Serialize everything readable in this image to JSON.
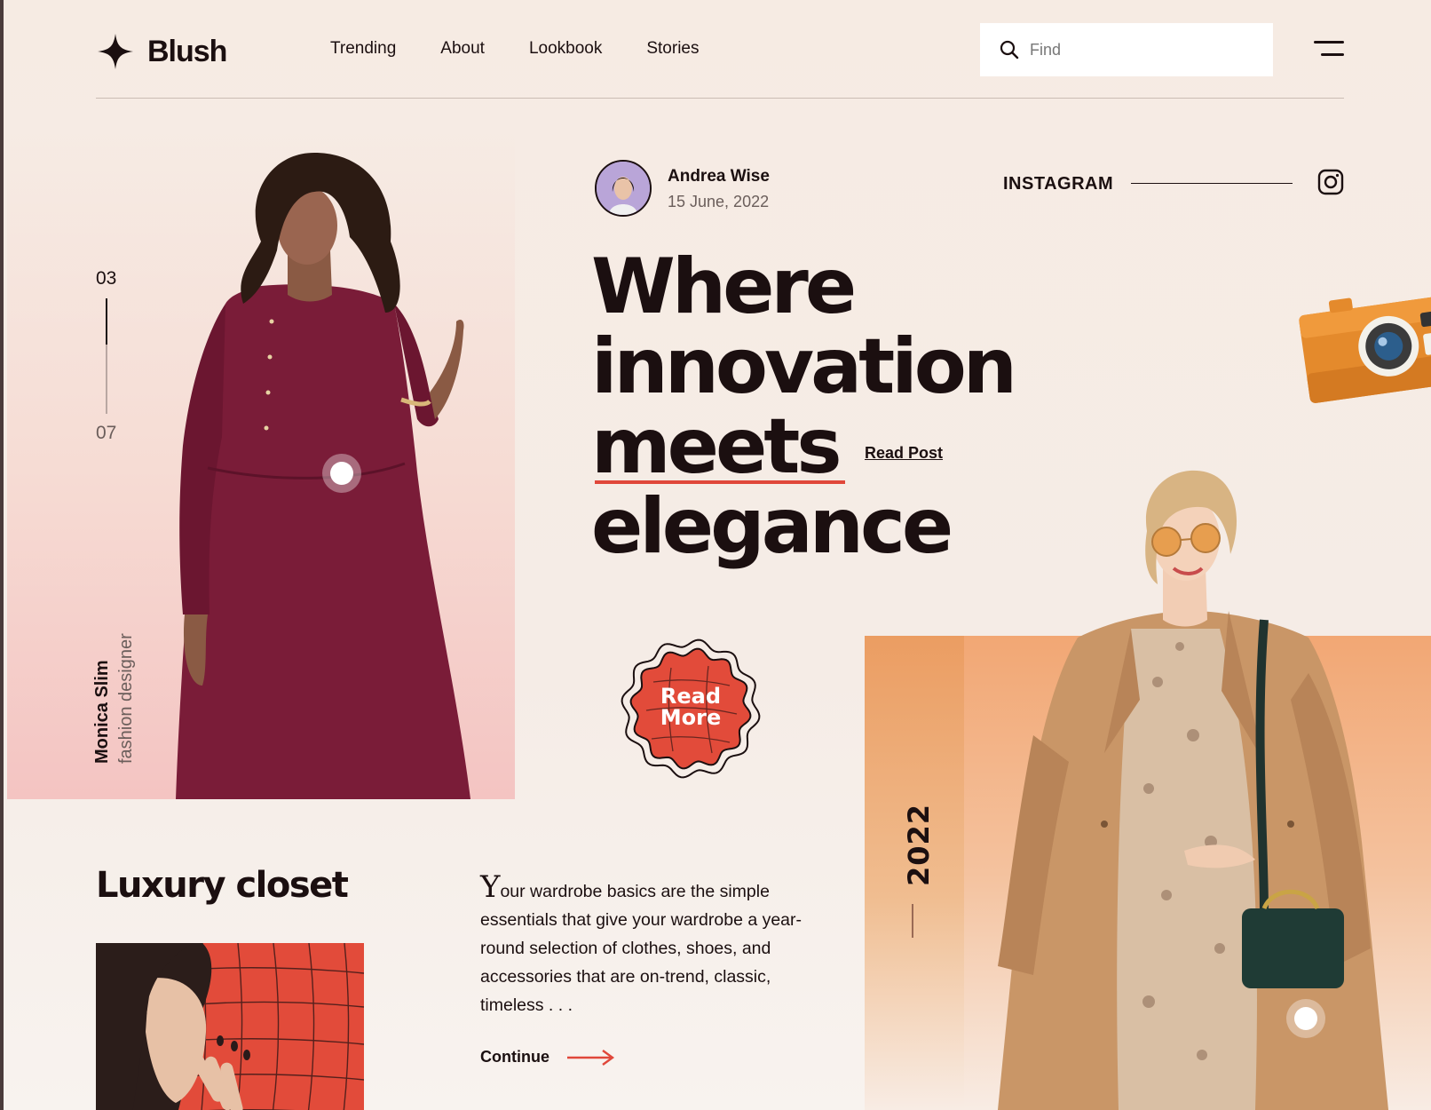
{
  "brand": {
    "name": "Blush",
    "accent": "#e0473a"
  },
  "nav": {
    "items": [
      "Trending",
      "About",
      "Lookbook",
      "Stories"
    ]
  },
  "search": {
    "placeholder": "Find",
    "value": ""
  },
  "slide_counter": {
    "current": "03",
    "total": "07"
  },
  "designer": {
    "name": "Monica Slim",
    "role": "fashion designer"
  },
  "author": {
    "name": "Andrea Wise",
    "date": "15 June, 2022"
  },
  "social": {
    "label": "INSTAGRAM"
  },
  "headline": {
    "line1": "Where",
    "line2": "innovation",
    "line3": "meets",
    "line4": "elegance"
  },
  "read_post": "Read Post",
  "read_more": {
    "line1": "Read",
    "line2": "More"
  },
  "year": "2022",
  "section": {
    "title": "Luxury closet",
    "drop_cap": "Y",
    "body": "our wardrobe basics are the simple essentials that give your wardrobe a year-round selection of clothes, shoes, and accessories that are on-trend, classic, timeless . . .",
    "cta": "Continue"
  },
  "icons": [
    "sparkle-logo-icon",
    "search-icon",
    "hamburger-menu-icon",
    "instagram-icon",
    "arrow-right-icon",
    "camera-icon"
  ]
}
